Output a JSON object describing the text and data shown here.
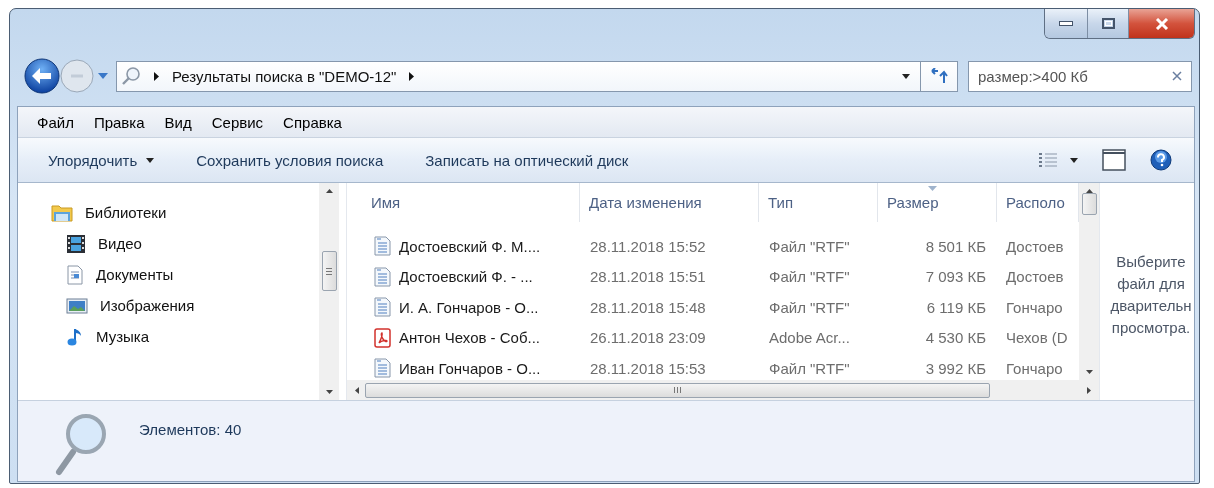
{
  "address_bar": {
    "segments": [
      "Результаты поиска в \"DEMO-12\""
    ]
  },
  "search": {
    "value": "размер:>400 Кб"
  },
  "menu": [
    "Файл",
    "Правка",
    "Вид",
    "Сервис",
    "Справка"
  ],
  "toolbar": {
    "buttons": [
      {
        "label": "Упорядочить",
        "dropdown": true
      },
      {
        "label": "Сохранить условия поиска",
        "dropdown": false
      },
      {
        "label": "Записать на оптический диск",
        "dropdown": false
      }
    ]
  },
  "navigation": {
    "items": [
      {
        "label": "Библиотеки",
        "kind": "libraries",
        "children": [
          {
            "label": "Видео",
            "kind": "video"
          },
          {
            "label": "Документы",
            "kind": "documents"
          },
          {
            "label": "Изображения",
            "kind": "pictures"
          },
          {
            "label": "Музыка",
            "kind": "music"
          }
        ]
      }
    ]
  },
  "file_list": {
    "columns": [
      {
        "label": "Имя",
        "sorted": false
      },
      {
        "label": "Дата изменения",
        "sorted": false
      },
      {
        "label": "Тип",
        "sorted": false
      },
      {
        "label": "Размер",
        "sorted": true
      },
      {
        "label": "Располо",
        "sorted": false
      }
    ],
    "rows": [
      {
        "kind": "rtf",
        "name": "Достоевский Ф. М....",
        "date": "28.11.2018 15:52",
        "type": "Файл \"RTF\"",
        "size": "8 501 КБ",
        "location": "Достоев"
      },
      {
        "kind": "rtf",
        "name": "Достоевский Ф. - ...",
        "date": "28.11.2018 15:51",
        "type": "Файл \"RTF\"",
        "size": "7 093 КБ",
        "location": "Достоев"
      },
      {
        "kind": "rtf",
        "name": "И. А. Гончаров - О...",
        "date": "28.11.2018 15:48",
        "type": "Файл \"RTF\"",
        "size": "6 119 КБ",
        "location": "Гончаро"
      },
      {
        "kind": "pdf",
        "name": "Антон Чехов - Соб...",
        "date": "26.11.2018 23:09",
        "type": "Adobe Acr...",
        "size": "4 530 КБ",
        "location": "Чехов (D"
      },
      {
        "kind": "rtf",
        "name": "Иван Гончаров - О...",
        "date": "28.11.2018 15:53",
        "type": "Файл \"RTF\"",
        "size": "3 992 КБ",
        "location": "Гончаро"
      }
    ]
  },
  "preview": {
    "lines": [
      "Выберите",
      "файл для",
      "дварительн",
      "просмотра."
    ]
  },
  "status_bar": {
    "text": "Элементов: 40"
  }
}
